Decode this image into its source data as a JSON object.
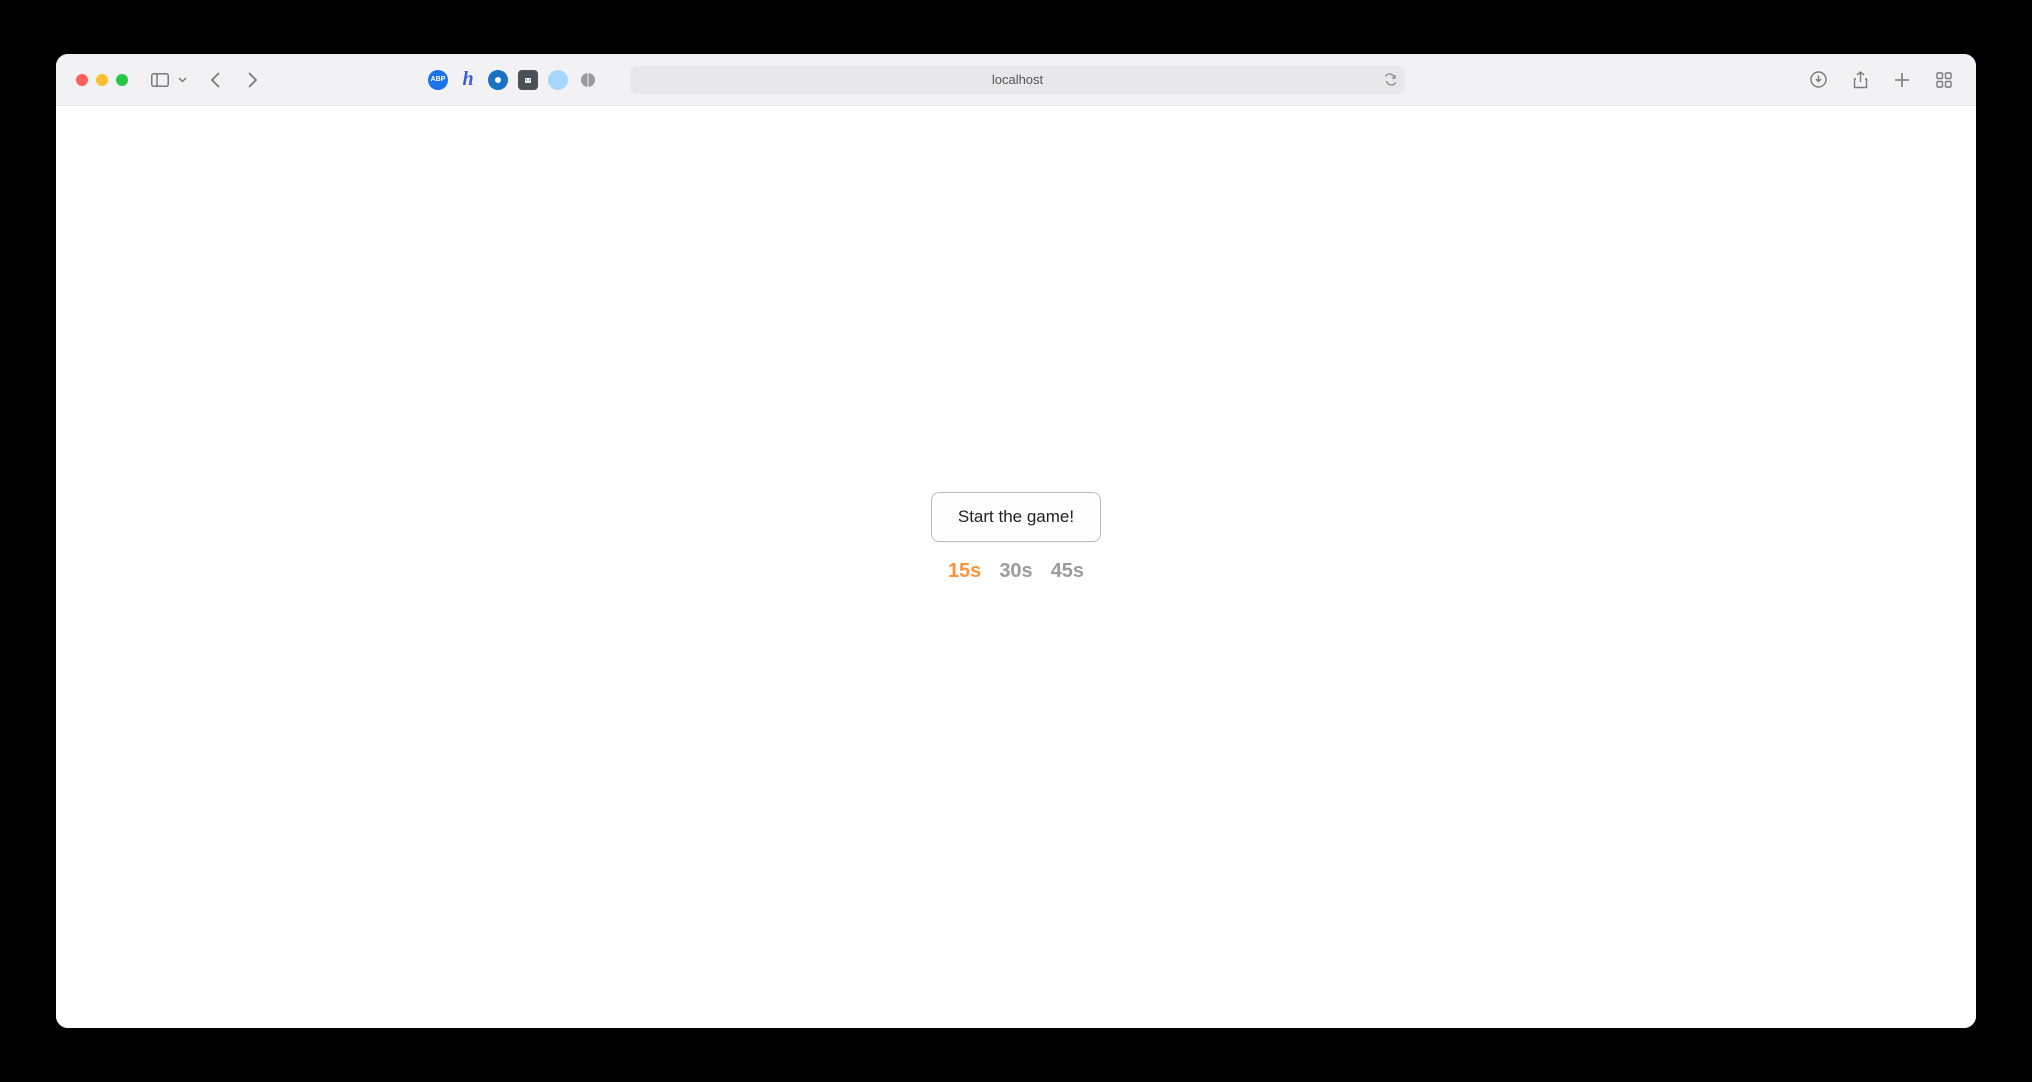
{
  "browser": {
    "address": "localhost",
    "extensions": [
      {
        "name": "adblock",
        "label": "ABP",
        "bg": "#1a73e8",
        "fg": "#fff"
      },
      {
        "name": "honey",
        "label": "h",
        "bg": "#3b5bdb",
        "fg": "#fff"
      },
      {
        "name": "octo",
        "label": "",
        "bg": "#1971c2",
        "fg": "#fff"
      },
      {
        "name": "robot",
        "label": "",
        "bg": "#495057",
        "fg": "#fff"
      },
      {
        "name": "circle",
        "label": "",
        "bg": "#a5d8ff",
        "fg": "#fff"
      },
      {
        "name": "shield",
        "label": "",
        "bg": "#adb5bd",
        "fg": "#fff"
      }
    ]
  },
  "game": {
    "start_label": "Start the game!",
    "time_options": [
      {
        "label": "15s",
        "active": true
      },
      {
        "label": "30s",
        "active": false
      },
      {
        "label": "45s",
        "active": false
      }
    ]
  }
}
